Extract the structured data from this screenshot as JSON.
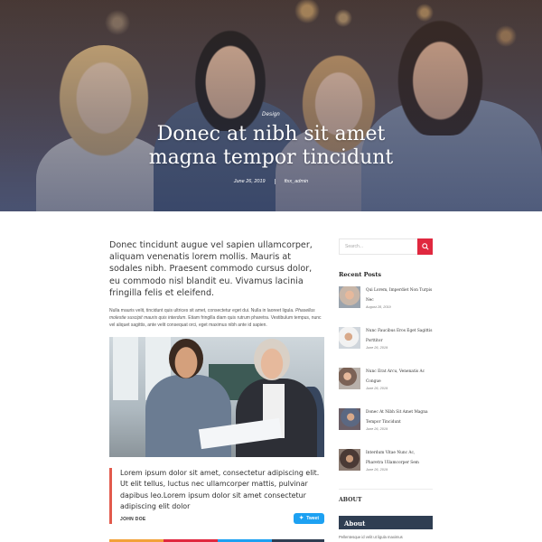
{
  "hero": {
    "category": "Design",
    "title_line1": "Donec at nibh sit amet",
    "title_line2": "magna tempor tincidunt",
    "date": "June 26, 2019",
    "author": "ftxx_admin"
  },
  "article": {
    "lead": "Donec tincidunt augue vel sapien ullamcorper, aliquam venenatis lorem mollis. Mauris at sodales nibh. Praesent commodo cursus dolor, eu commodo nisl blandit eu. Vivamus lacinia fringilla felis et eleifend.",
    "body_part1": "Nulla mauris velit, tincidunt quis ultrices sit amet, consectetur eget dui. Nulla in laoreet ligula. ",
    "body_italic": "Phasellus molestie suscipit mauris quis interdum.",
    "body_part2": " Etiam fringilla diam quis rutrum pharetra. Vestibulum tempus, nunc vel aliquet sagittis, ante velit consequat orci, eget maximus nibh ante id sapien.",
    "quote": "Lorem ipsum dolor sit amet, consectetur adipiscing elit. Ut elit tellus, luctus nec ullamcorper mattis, pulvinar dapibus leo.Lorem ipsum dolor sit amet consectetur adipiscing elit dolor",
    "quote_author": "JOHN DOE",
    "tweet_label": "Tweet"
  },
  "sidebar": {
    "search_placeholder": "Search...",
    "recent_heading": "Recent Posts",
    "posts": [
      {
        "title": "Qui Lorem, Imperdiet Non Turpis Nec",
        "date": "August 28, 2019"
      },
      {
        "title": "Nunc Faucibus Eros Eget Sagittis Porttitor",
        "date": "June 26, 2019"
      },
      {
        "title": "Nunc Erat Arcu, Venenatis Ac Congue",
        "date": "June 26, 2019"
      },
      {
        "title": "Donec At Nibh Sit Amet Magna Tempor Tincidunt",
        "date": "June 26, 2019"
      },
      {
        "title": "Interdum Vitae Nunc Ac, Pharetra Ullamcorper Sem",
        "date": "June 26, 2019"
      }
    ],
    "about_label": "ABOUT",
    "about_box_title": "About",
    "about_text": "Pellentesque id velit ut ligula maximus"
  },
  "colors": {
    "accent": "#e0283f",
    "quote_border": "#e25a4c",
    "tweet": "#1da1f2",
    "about_box": "#2f3e52"
  }
}
